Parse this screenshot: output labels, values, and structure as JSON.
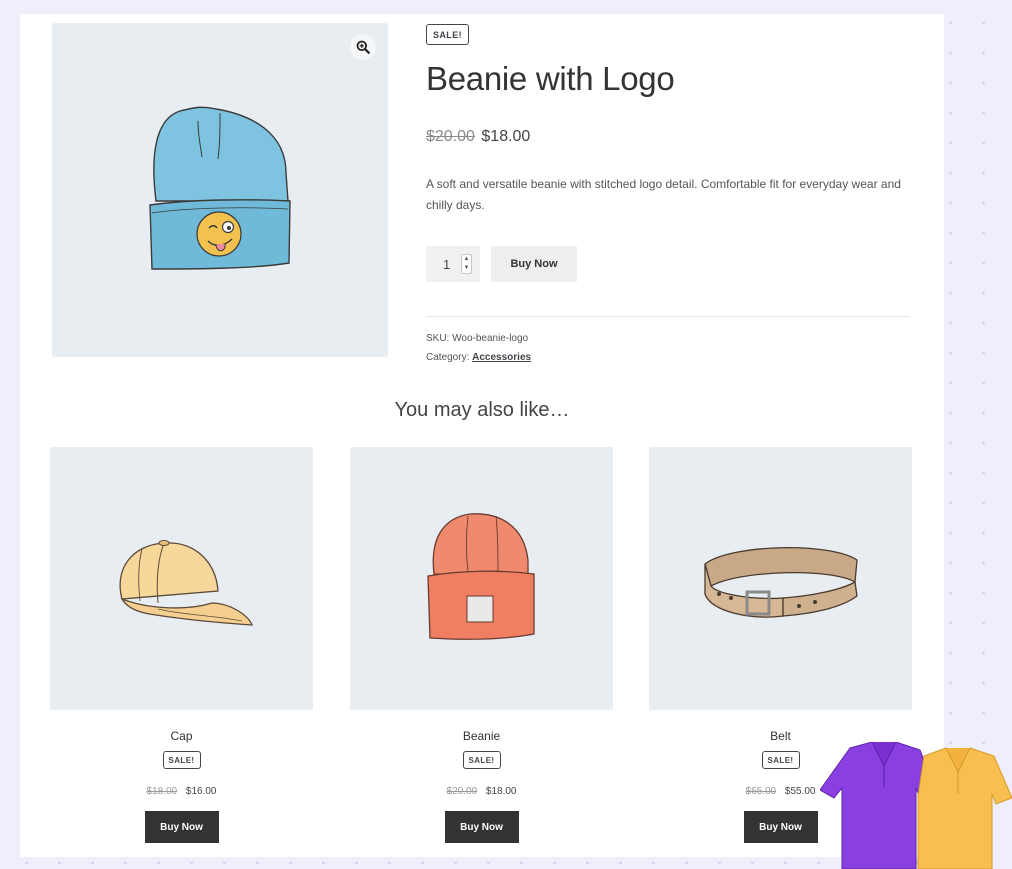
{
  "product": {
    "sale_badge": "SALE!",
    "title": "Beanie with Logo",
    "price_old": "$20.00",
    "price_new": "$18.00",
    "description": "A soft and versatile beanie with stitched logo detail. Comfortable fit for everyday wear and chilly days.",
    "quantity": "1",
    "buy_label": "Buy Now",
    "sku_text": "SKU: Woo-beanie-logo",
    "category_label": "Category:",
    "category_link": "Accessories",
    "zoom_icon": "zoom-in-icon",
    "image_subject": "beanie-with-logo"
  },
  "related": {
    "title": "You may also like…",
    "items": [
      {
        "name": "Cap",
        "badge": "SALE!",
        "price_old": "$18.00",
        "price_new": "$16.00",
        "button": "Buy Now",
        "image_subject": "cap"
      },
      {
        "name": "Beanie",
        "badge": "SALE!",
        "price_old": "$20.00",
        "price_new": "$18.00",
        "button": "Buy Now",
        "image_subject": "beanie"
      },
      {
        "name": "Belt",
        "badge": "SALE!",
        "price_old": "$65.00",
        "price_new": "$55.00",
        "button": "Buy Now",
        "image_subject": "belt"
      }
    ]
  },
  "decor": {
    "shirt_colors": [
      "#8a3fe0",
      "#f8bf4f"
    ]
  },
  "colors": {
    "image_bg": "#e8edf1",
    "dark_button": "#333333",
    "light_button": "#eeeeee",
    "page_bg": "#efeefb"
  }
}
